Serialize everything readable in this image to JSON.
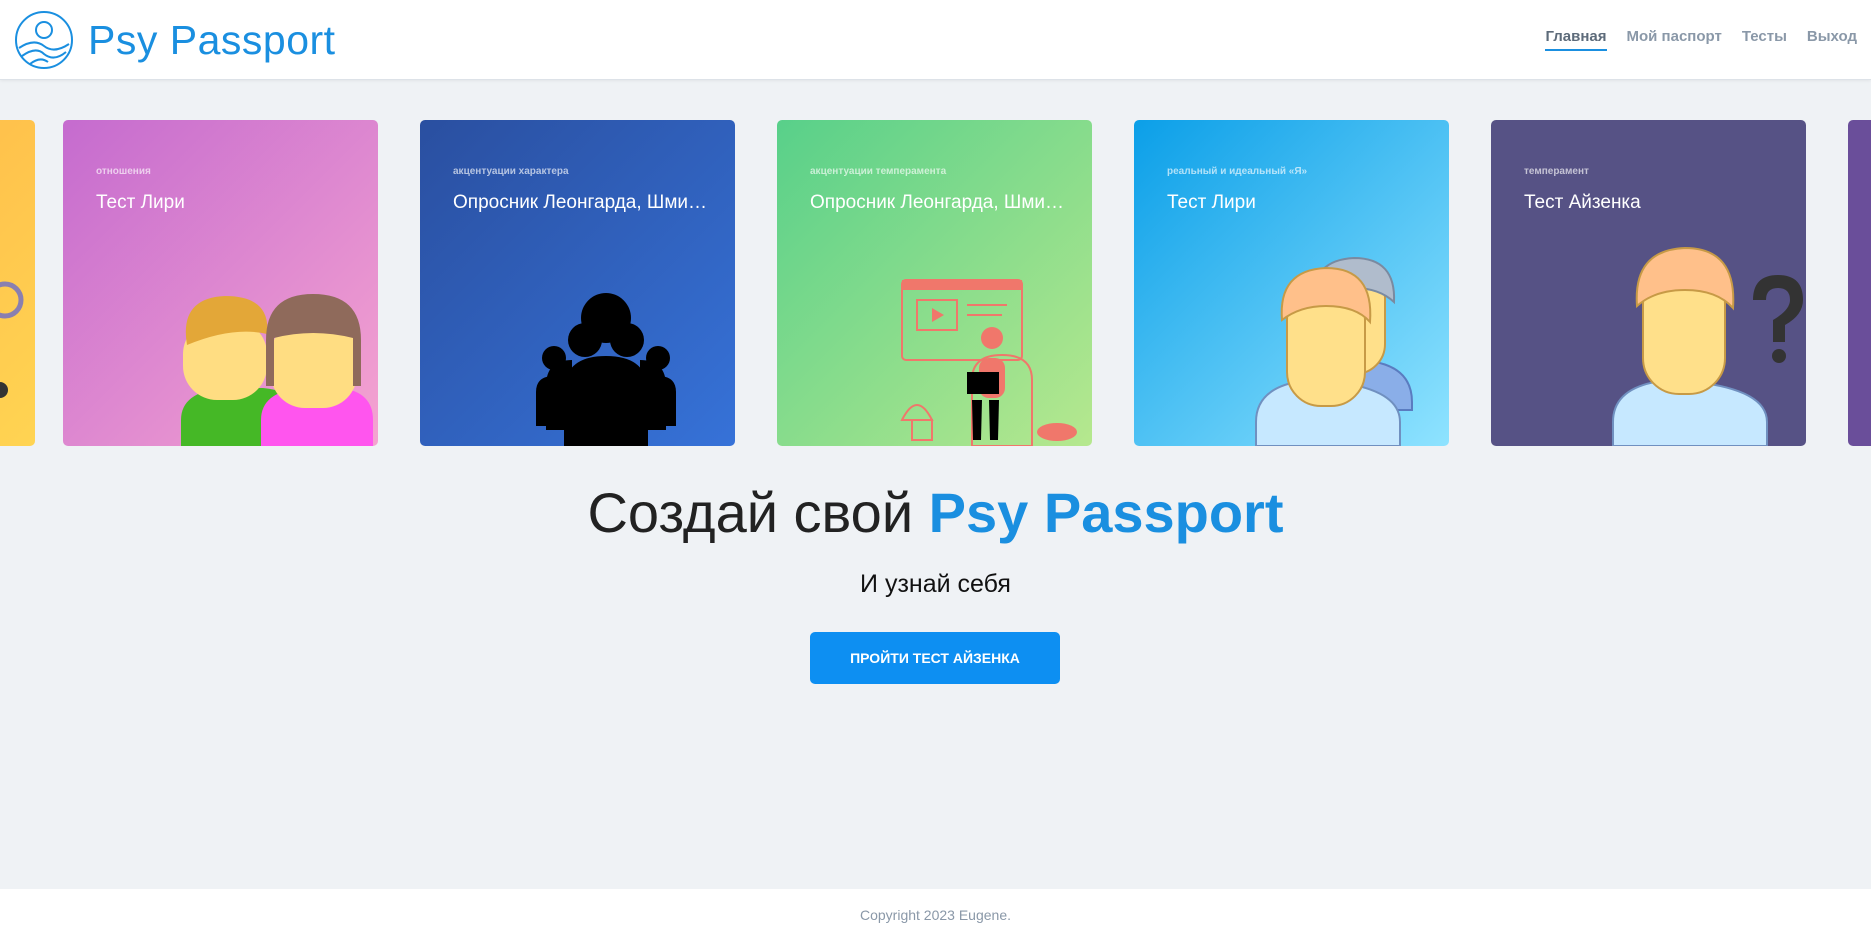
{
  "header": {
    "logo_text": "Psy Passport",
    "nav": [
      {
        "label": "Главная",
        "active": true
      },
      {
        "label": "Мой паспорт",
        "active": false
      },
      {
        "label": "Тесты",
        "active": false
      },
      {
        "label": "Выход",
        "active": false
      }
    ]
  },
  "carousel": {
    "cards": [
      {
        "category": "",
        "title": "",
        "illustration": "partial-card"
      },
      {
        "category": "отношения",
        "title": "Тест Лири",
        "illustration": "couple-icon"
      },
      {
        "category": "акцентуации характера",
        "title": "Опросник Леонгарда, Шмишека",
        "illustration": "group-people-icon"
      },
      {
        "category": "акцентуации темперамента",
        "title": "Опросник Леонгарда, Шмишека",
        "illustration": "student-laptop-icon"
      },
      {
        "category": "реальный и идеальный «Я»",
        "title": "Тест Лири",
        "illustration": "two-men-icon"
      },
      {
        "category": "темперамент",
        "title": "Тест Айзенка",
        "illustration": "man-question-icon"
      },
      {
        "category": "",
        "title": "",
        "illustration": "partial-card"
      }
    ]
  },
  "hero": {
    "title_prefix": "Создай свой ",
    "title_brand": "Psy Passport",
    "subtitle": "И узнай себя",
    "cta_label": "ПРОЙТИ ТЕСТ АЙЗЕНКА"
  },
  "footer": {
    "copyright": "Copyright 2023 Eugene."
  },
  "colors": {
    "accent": "#1a8fe0",
    "button": "#0d8ff2",
    "page_bg": "#eff2f5"
  }
}
